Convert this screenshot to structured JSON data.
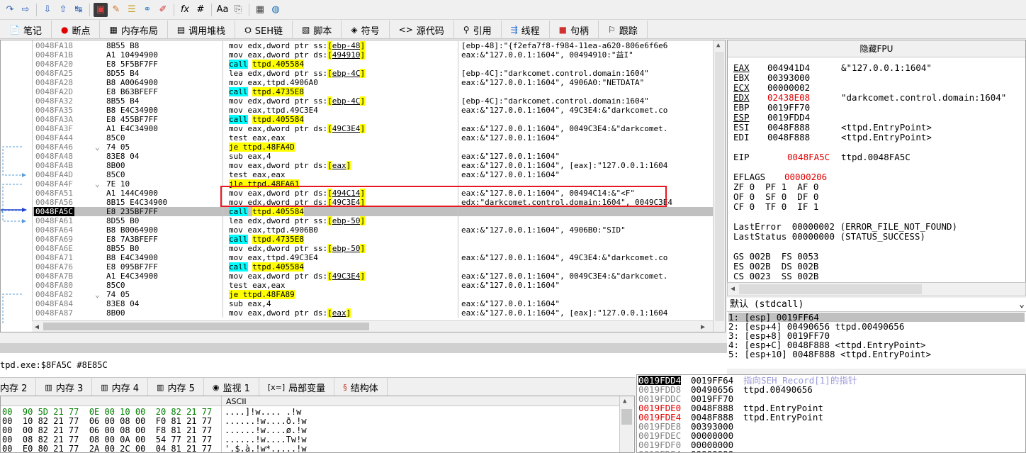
{
  "toolbar": {
    "icons": [
      "redo-icon",
      "step-into-icon",
      "step-over-icon",
      "run-to-user-icon",
      "animate-icon",
      "stop-icon",
      "highlight-icon",
      "comment-icon",
      "label-icon",
      "bookmark-icon",
      "fx-icon",
      "hash-icon",
      "font-icon",
      "paste-icon",
      "calculator-icon",
      "globe-icon"
    ]
  },
  "tabs": [
    {
      "icon": "📄",
      "label": "笔记"
    },
    {
      "icon": "●",
      "label": "断点"
    },
    {
      "icon": "▦",
      "label": "内存布局"
    },
    {
      "icon": "▤",
      "label": "调用堆栈"
    },
    {
      "icon": "⛭",
      "label": "SEH链"
    },
    {
      "icon": "▧",
      "label": "脚本"
    },
    {
      "icon": "◈",
      "label": "符号"
    },
    {
      "icon": "<>",
      "label": "源代码"
    },
    {
      "icon": "⚲",
      "label": "引用"
    },
    {
      "icon": "⇶",
      "label": "线程"
    },
    {
      "icon": "■",
      "label": "句柄"
    },
    {
      "icon": "⚐",
      "label": "跟踪"
    }
  ],
  "disasm": [
    {
      "addr": "0048FA18",
      "bytes": "8B55 B8",
      "ins": "mov edx,dword ptr ss:[ebp-48]",
      "cmt": "[ebp-48]:\"{f2efa7f8-f984-11ea-a620-806e6f6e6"
    },
    {
      "addr": "0048FA1B",
      "bytes": "A1 10494900",
      "ins": "mov eax,dword ptr ds:[494910]",
      "cmt": "eax:&\"127.0.0.1:1604\", 00494910:\"益I\""
    },
    {
      "addr": "0048FA20",
      "bytes": "E8 5F5BF7FF",
      "ins": "call ttpd.405584",
      "cmt": ""
    },
    {
      "addr": "0048FA25",
      "bytes": "8D55 B4",
      "ins": "lea edx,dword ptr ss:[ebp-4C]",
      "cmt": "[ebp-4C]:\"darkcomet.control.domain:1604\""
    },
    {
      "addr": "0048FA28",
      "bytes": "B8 A0064900",
      "ins": "mov eax,ttpd.4906A0",
      "cmt": "eax:&\"127.0.0.1:1604\", 4906A0:\"NETDATA\""
    },
    {
      "addr": "0048FA2D",
      "bytes": "E8 B63BFEFF",
      "ins": "call ttpd.4735E8",
      "cmt": ""
    },
    {
      "addr": "0048FA32",
      "bytes": "8B55 B4",
      "ins": "mov edx,dword ptr ss:[ebp-4C]",
      "cmt": "[ebp-4C]:\"darkcomet.control.domain:1604\""
    },
    {
      "addr": "0048FA35",
      "bytes": "B8 E4C34900",
      "ins": "mov eax,ttpd.49C3E4",
      "cmt": "eax:&\"127.0.0.1:1604\", 49C3E4:&\"darkcomet.co"
    },
    {
      "addr": "0048FA3A",
      "bytes": "E8 455BF7FF",
      "ins": "call ttpd.405584",
      "cmt": ""
    },
    {
      "addr": "0048FA3F",
      "bytes": "A1 E4C34900",
      "ins": "mov eax,dword ptr ds:[49C3E4]",
      "cmt": "eax:&\"127.0.0.1:1604\", 0049C3E4:&\"darkcomet."
    },
    {
      "addr": "0048FA44",
      "bytes": "85C0",
      "ins": "test eax,eax",
      "cmt": "eax:&\"127.0.0.1:1604\""
    },
    {
      "addr": "0048FA46",
      "bytes": "74 05",
      "ins": "je ttpd.48FA4D",
      "cmt": ""
    },
    {
      "addr": "0048FA48",
      "bytes": "83E8 04",
      "ins": "sub eax,4",
      "cmt": "eax:&\"127.0.0.1:1604\""
    },
    {
      "addr": "0048FA4B",
      "bytes": "8B00",
      "ins": "mov eax,dword ptr ds:[eax]",
      "cmt": "eax:&\"127.0.0.1:1604\", [eax]:\"127.0.0.1:1604"
    },
    {
      "addr": "0048FA4D",
      "bytes": "85C0",
      "ins": "test eax,eax",
      "cmt": "eax:&\"127.0.0.1:1604\""
    },
    {
      "addr": "0048FA4F",
      "bytes": "7E 10",
      "ins": "jle ttpd.48FA61",
      "cmt": ""
    },
    {
      "addr": "0048FA51",
      "bytes": "A1 144C4900",
      "ins": "mov eax,dword ptr ds:[494C14]",
      "cmt": "eax:&\"127.0.0.1:1604\", 00494C14:&\"<F\""
    },
    {
      "addr": "0048FA56",
      "bytes": "8B15 E4C34900",
      "ins": "mov edx,dword ptr ds:[49C3E4]",
      "cmt": "edx:\"darkcomet.control.domain:1604\", 0049C3E4"
    },
    {
      "addr": "0048FA5C",
      "bytes": "E8 235BF7FF",
      "ins": "call ttpd.405584",
      "cmt": ""
    },
    {
      "addr": "0048FA61",
      "bytes": "8D55 B0",
      "ins": "lea edx,dword ptr ss:[ebp-50]",
      "cmt": ""
    },
    {
      "addr": "0048FA64",
      "bytes": "B8 B0064900",
      "ins": "mov eax,ttpd.4906B0",
      "cmt": "eax:&\"127.0.0.1:1604\", 4906B0:\"SID\""
    },
    {
      "addr": "0048FA69",
      "bytes": "E8 7A3BFEFF",
      "ins": "call ttpd.4735E8",
      "cmt": ""
    },
    {
      "addr": "0048FA6E",
      "bytes": "8B55 B0",
      "ins": "mov edx,dword ptr ss:[ebp-50]",
      "cmt": ""
    },
    {
      "addr": "0048FA71",
      "bytes": "B8 E4C34900",
      "ins": "mov eax,ttpd.49C3E4",
      "cmt": "eax:&\"127.0.0.1:1604\", 49C3E4:&\"darkcomet.co"
    },
    {
      "addr": "0048FA76",
      "bytes": "E8 095BF7FF",
      "ins": "call ttpd.405584",
      "cmt": ""
    },
    {
      "addr": "0048FA7B",
      "bytes": "A1 E4C34900",
      "ins": "mov eax,dword ptr ds:[49C3E4]",
      "cmt": "eax:&\"127.0.0.1:1604\", 0049C3E4:&\"darkcomet."
    },
    {
      "addr": "0048FA80",
      "bytes": "85C0",
      "ins": "test eax,eax",
      "cmt": "eax:&\"127.0.0.1:1604\""
    },
    {
      "addr": "0048FA82",
      "bytes": "74 05",
      "ins": "je ttpd.48FA89",
      "cmt": ""
    },
    {
      "addr": "0048FA84",
      "bytes": "83E8 04",
      "ins": "sub eax,4",
      "cmt": "eax:&\"127.0.0.1:1604\""
    },
    {
      "addr": "0048FA87",
      "bytes": "8B00",
      "ins": "mov eax,dword ptr ds:[eax]",
      "cmt": "eax:&\"127.0.0.1:1604\", [eax]:\"127.0.0.1:1604"
    }
  ],
  "regs_title": "隐藏FPU",
  "regs": [
    {
      "name": "EAX",
      "val": "004941D4",
      "desc": "&\"127.0.0.1:1604\""
    },
    {
      "name": "EBX",
      "val": "00393000",
      "desc": ""
    },
    {
      "name": "ECX",
      "val": "00000002",
      "desc": ""
    },
    {
      "name": "EDX",
      "val": "02438E08",
      "desc": "\"darkcomet.control.domain:1604\""
    },
    {
      "name": "EBP",
      "val": "0019FF70",
      "desc": ""
    },
    {
      "name": "ESP",
      "val": "0019FDD4",
      "desc": ""
    },
    {
      "name": "ESI",
      "val": "0048F888",
      "desc": "<ttpd.EntryPoint>"
    },
    {
      "name": "EDI",
      "val": "0048F888",
      "desc": "<ttpd.EntryPoint>"
    }
  ],
  "eip": {
    "name": "EIP",
    "val": "0048FA5C",
    "desc": "ttpd.0048FA5C"
  },
  "eflags": {
    "name": "EFLAGS",
    "val": "00000206"
  },
  "flags": [
    "ZF 0  PF 1  AF 0",
    "OF 0  SF 0  DF 0",
    "CF 0  TF 0  IF 1"
  ],
  "lasterror": "LastError  00000002 (ERROR_FILE_NOT_FOUND)",
  "laststatus": "LastStatus 00000000 (STATUS_SUCCESS)",
  "segs": [
    "GS 002B  FS 0053",
    "ES 002B  DS 002B",
    "CS 0023  SS 002B"
  ],
  "callconv": "默认 (stdcall)",
  "callargs": [
    "1: [esp] 0019FF64",
    "2: [esp+4] 00490656 ttpd.00490656",
    "3: [esp+8] 0019FF70",
    "4: [esp+C] 0048F888 <ttpd.EntryPoint>",
    "5: [esp+10] 0048F888 <ttpd.EntryPoint>"
  ],
  "status_line": "tpd.exe:$8FA5C #8E85C",
  "bottom_tabs": [
    {
      "icon": "",
      "label": "内存 2"
    },
    {
      "icon": "▥",
      "label": "内存 3"
    },
    {
      "icon": "▥",
      "label": "内存 4"
    },
    {
      "icon": "▥",
      "label": "内存 5"
    },
    {
      "icon": "◉",
      "label": "监视 1"
    },
    {
      "icon": "[x=]",
      "label": "局部变量"
    },
    {
      "icon": "§",
      "label": "结构体"
    }
  ],
  "ascii_header": "ASCII",
  "dump_rows": [
    {
      "hex": "00  90 5D 21 77  0E 00 10 00  20 82 21 77",
      "ascii": "....]!w.... .!w"
    },
    {
      "hex": "00  10 82 21 77  06 00 08 00  F0 81 21 77",
      "ascii": "......!w....ð.!w"
    },
    {
      "hex": "00  00 82 21 77  06 00 08 00  F8 81 21 77",
      "ascii": "......!w....ø.!w"
    },
    {
      "hex": "00  08 82 21 77  08 00 0A 00  54 77 21 77",
      "ascii": "......!w....Tw!w"
    },
    {
      "hex": "00  E0 80 21 77  2A 00 2C 00  04 81 21 77",
      "ascii": "'.$.à.!w*.,...!w"
    }
  ],
  "stack_rows": [
    {
      "addr": "0019FDD4",
      "val": "0019FF64",
      "cmt": "指向SEH_Record[1]的指针"
    },
    {
      "addr": "0019FDD8",
      "val": "00490656",
      "cmt": "ttpd.00490656"
    },
    {
      "addr": "0019FDDC",
      "val": "0019FF70",
      "cmt": ""
    },
    {
      "addr": "0019FDE0",
      "val": "0048F888",
      "cmt": "ttpd.EntryPoint"
    },
    {
      "addr": "0019FDE4",
      "val": "0048F888",
      "cmt": "ttpd.EntryPoint"
    },
    {
      "addr": "0019FDE8",
      "val": "00393000",
      "cmt": ""
    },
    {
      "addr": "0019FDEC",
      "val": "00000000",
      "cmt": ""
    },
    {
      "addr": "0019FDF0",
      "val": "00000000",
      "cmt": ""
    },
    {
      "addr": "0019FDF4",
      "val": "00000000",
      "cmt": ""
    }
  ]
}
